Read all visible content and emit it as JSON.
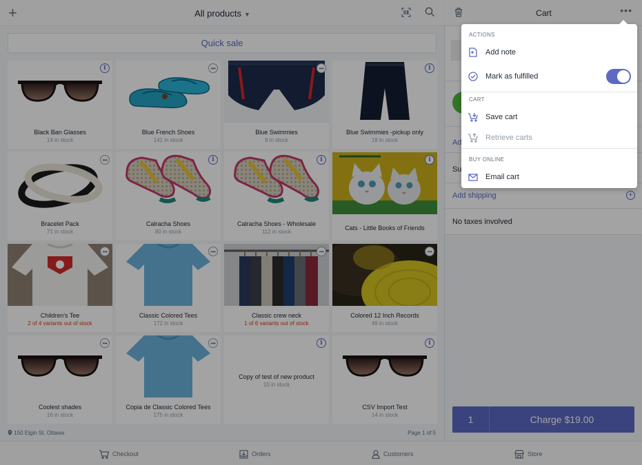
{
  "header": {
    "title": "All products",
    "add_icon": "plus-icon",
    "barcode_icon": "barcode-icon",
    "search_icon": "search-icon"
  },
  "quick_sale": "Quick sale",
  "products": [
    {
      "name": "Black Ban Glasses",
      "stock": "14 in stock",
      "badge": "info",
      "image": "sunglasses"
    },
    {
      "name": "Blue French Shoes",
      "stock": "141 in stock",
      "badge": "more",
      "image": "blue-shoes"
    },
    {
      "name": "Blue Swimmies",
      "stock": "9 in stock",
      "badge": "more",
      "image": "swim-shorts"
    },
    {
      "name": "Blue Swimmies -pickup only",
      "stock": "18 in stock",
      "badge": "info",
      "image": "shorts"
    },
    {
      "name": "Bracelet Pack",
      "stock": "71 in stock",
      "badge": "more",
      "image": "bracelets"
    },
    {
      "name": "Calracha Shoes",
      "stock": "80 in stock",
      "badge": "info",
      "image": "woven-shoes"
    },
    {
      "name": "Calracha Shoes - Wholesale",
      "stock": "112 in stock",
      "badge": "info",
      "image": "woven-shoes"
    },
    {
      "name": "Cats - Little Books of Friends",
      "stock": "",
      "badge": "info",
      "image": "cats-book"
    },
    {
      "name": "Children's Tee",
      "stock": "2 of 4 variants out of stock",
      "stock_warning": true,
      "badge": "more",
      "image": "white-tee"
    },
    {
      "name": "Classic Colored Tees",
      "stock": "172 in stock",
      "badge": "more",
      "image": "blue-tee"
    },
    {
      "name": "Classic crew neck",
      "stock": "1 of 6 variants out of stock",
      "stock_warning": true,
      "badge": "more",
      "image": "clothes-rack"
    },
    {
      "name": "Colored 12 Inch Records",
      "stock": "49 in stock",
      "badge": "more",
      "image": "records"
    },
    {
      "name": "Coolest shades",
      "stock": "16 in stock",
      "badge": "more",
      "image": "sunglasses"
    },
    {
      "name": "Copia de Classic Colored Tees",
      "stock": "175 in stock",
      "badge": "more",
      "image": "blue-tee"
    },
    {
      "name": "Copy of test of new product",
      "stock": "10 in stock",
      "badge": "info",
      "image": "none"
    },
    {
      "name": "CSV Import Test",
      "stock": "14 in stock",
      "badge": "info",
      "image": "sunglasses"
    }
  ],
  "footer": {
    "location": "150 Elgin St, Ottawa",
    "page": "Page 1 of 5"
  },
  "cart": {
    "title": "Cart",
    "add_discount": "Add",
    "subtotal": "Su",
    "add_shipping": "Add shipping",
    "taxes": "No taxes involved",
    "quantity": "1",
    "charge": "Charge $19.00"
  },
  "menu": {
    "actions_header": "ACTIONS",
    "add_note": "Add note",
    "mark_fulfilled": "Mark as fulfilled",
    "mark_fulfilled_on": true,
    "cart_header": "CART",
    "save_cart": "Save cart",
    "retrieve_carts": "Retrieve carts",
    "buy_online_header": "BUY ONLINE",
    "email_cart": "Email cart"
  },
  "nav": {
    "checkout": "Checkout",
    "orders": "Orders",
    "customers": "Customers",
    "store": "Store"
  },
  "colors": {
    "accent": "#5c6ac4",
    "warning": "#de3618",
    "avatar": "#50b83c"
  }
}
